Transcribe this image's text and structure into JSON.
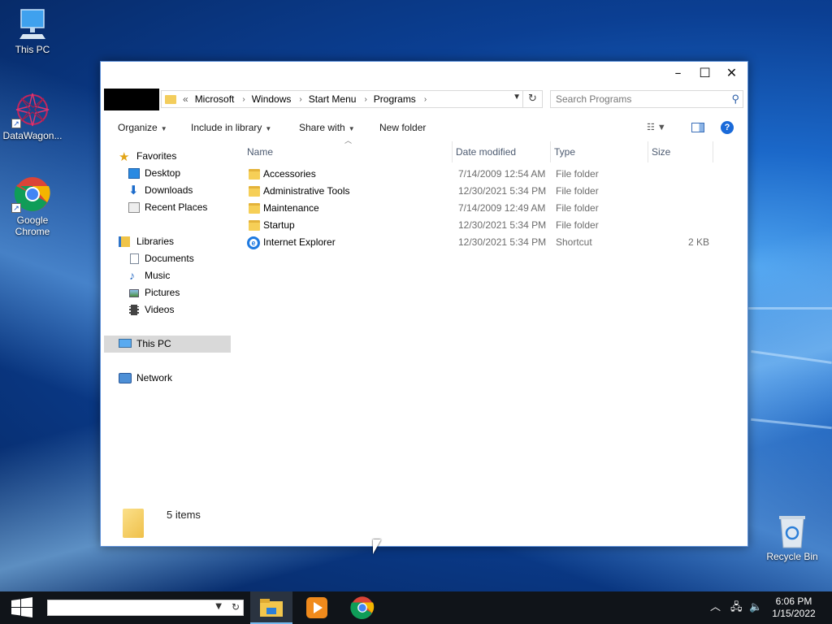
{
  "desktop": {
    "icons": [
      {
        "label": "This PC",
        "icon": "computer-icon"
      },
      {
        "label": "DataWagon...",
        "icon": "datawagon-icon"
      },
      {
        "label": "Google Chrome",
        "icon": "chrome-icon"
      },
      {
        "label": "Recycle Bin",
        "icon": "recycle-bin-icon"
      }
    ]
  },
  "window": {
    "caption": {
      "minimize": "–",
      "maximize": "☐",
      "close": "✕"
    },
    "address": {
      "prefix": "«",
      "crumbs": [
        "Microsoft",
        "Windows",
        "Start Menu",
        "Programs"
      ]
    },
    "search_placeholder": "Search Programs",
    "commands": {
      "organize": "Organize",
      "include_in_library": "Include in library",
      "share_with": "Share with",
      "new_folder": "New folder"
    },
    "nav": {
      "favorites": "Favorites",
      "desktop": "Desktop",
      "downloads": "Downloads",
      "recent_places": "Recent Places",
      "libraries": "Libraries",
      "documents": "Documents",
      "music": "Music",
      "pictures": "Pictures",
      "videos": "Videos",
      "this_pc": "This PC",
      "network": "Network"
    },
    "columns": {
      "name": "Name",
      "date_modified": "Date modified",
      "type": "Type",
      "size": "Size"
    },
    "files": [
      {
        "name": "Accessories",
        "date": "7/14/2009 12:54 AM",
        "type": "File folder",
        "size": ""
      },
      {
        "name": "Administrative Tools",
        "date": "12/30/2021 5:34 PM",
        "type": "File folder",
        "size": ""
      },
      {
        "name": "Maintenance",
        "date": "7/14/2009 12:49 AM",
        "type": "File folder",
        "size": ""
      },
      {
        "name": "Startup",
        "date": "12/30/2021 5:34 PM",
        "type": "File folder",
        "size": ""
      },
      {
        "name": "Internet Explorer",
        "date": "12/30/2021 5:34 PM",
        "type": "Shortcut",
        "size": "2 KB"
      }
    ],
    "status": {
      "items_count": "5 items"
    }
  },
  "taskbar": {
    "clock_time": "6:06 PM",
    "clock_date": "1/15/2022"
  }
}
